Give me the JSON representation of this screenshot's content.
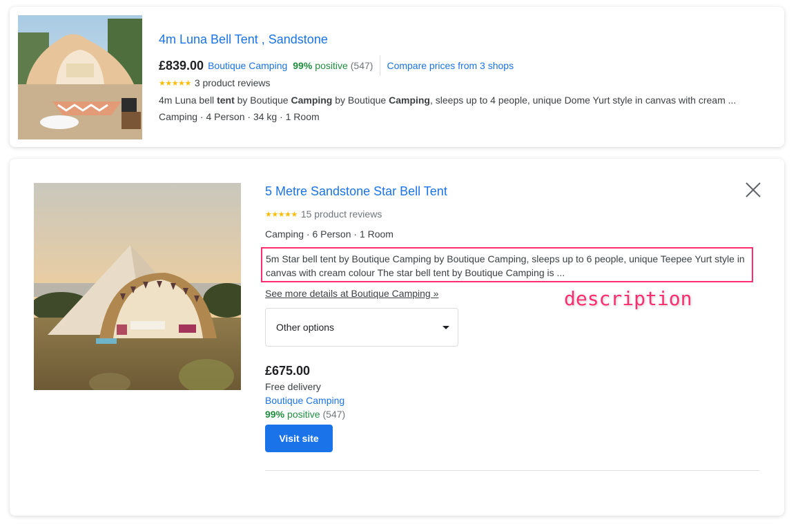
{
  "results": [
    {
      "title": "4m Luna Bell Tent , Sandstone",
      "price": "£839.00",
      "seller": "Boutique Camping",
      "positive_pct": "99%",
      "positive_word": "positive",
      "positive_count": "(547)",
      "compare_label": "Compare prices from 3 shops",
      "stars_glyph": "★★★★★",
      "rating_stars": 5,
      "reviews": "3 product reviews",
      "description_parts": [
        {
          "text": "4m Luna bell ",
          "bold": false
        },
        {
          "text": "tent",
          "bold": true
        },
        {
          "text": " by Boutique ",
          "bold": false
        },
        {
          "text": "Camping",
          "bold": true
        },
        {
          "text": " by Boutique ",
          "bold": false
        },
        {
          "text": "Camping",
          "bold": true
        },
        {
          "text": ", sleeps up to 4 people, unique Dome Yurt style in canvas with cream ...",
          "bold": false
        }
      ],
      "attributes": "Camping · 4 Person · 34 kg · 1 Room",
      "image_icon": "tent-photo"
    },
    {
      "title": "5 Metre Sandstone Star Bell Tent",
      "stars_glyph": "★★★★★",
      "rating_stars": 5,
      "reviews": "15 product reviews",
      "attributes": "Camping · 6 Person · 1 Room",
      "description": "5m Star bell tent by Boutique Camping by Boutique Camping, sleeps up to 6 people, unique Teepee Yurt style in canvas with cream colour The star bell tent by Boutique Camping is ...",
      "see_more": "See more details at Boutique Camping »",
      "options_select": "Other options",
      "price": "£675.00",
      "delivery": "Free delivery",
      "seller": "Boutique Camping",
      "positive_pct": "99%",
      "positive_word": "positive",
      "positive_count": "(547)",
      "visit_label": "Visit site",
      "close_icon": "close-icon",
      "image_icon": "tent-photo"
    }
  ],
  "annotation": {
    "label": "description",
    "color": "#ff2d6f"
  },
  "colors": {
    "link": "#1a73e8",
    "positive": "#1e8e3e",
    "star": "#fbbc04",
    "button": "#1a73e8"
  }
}
